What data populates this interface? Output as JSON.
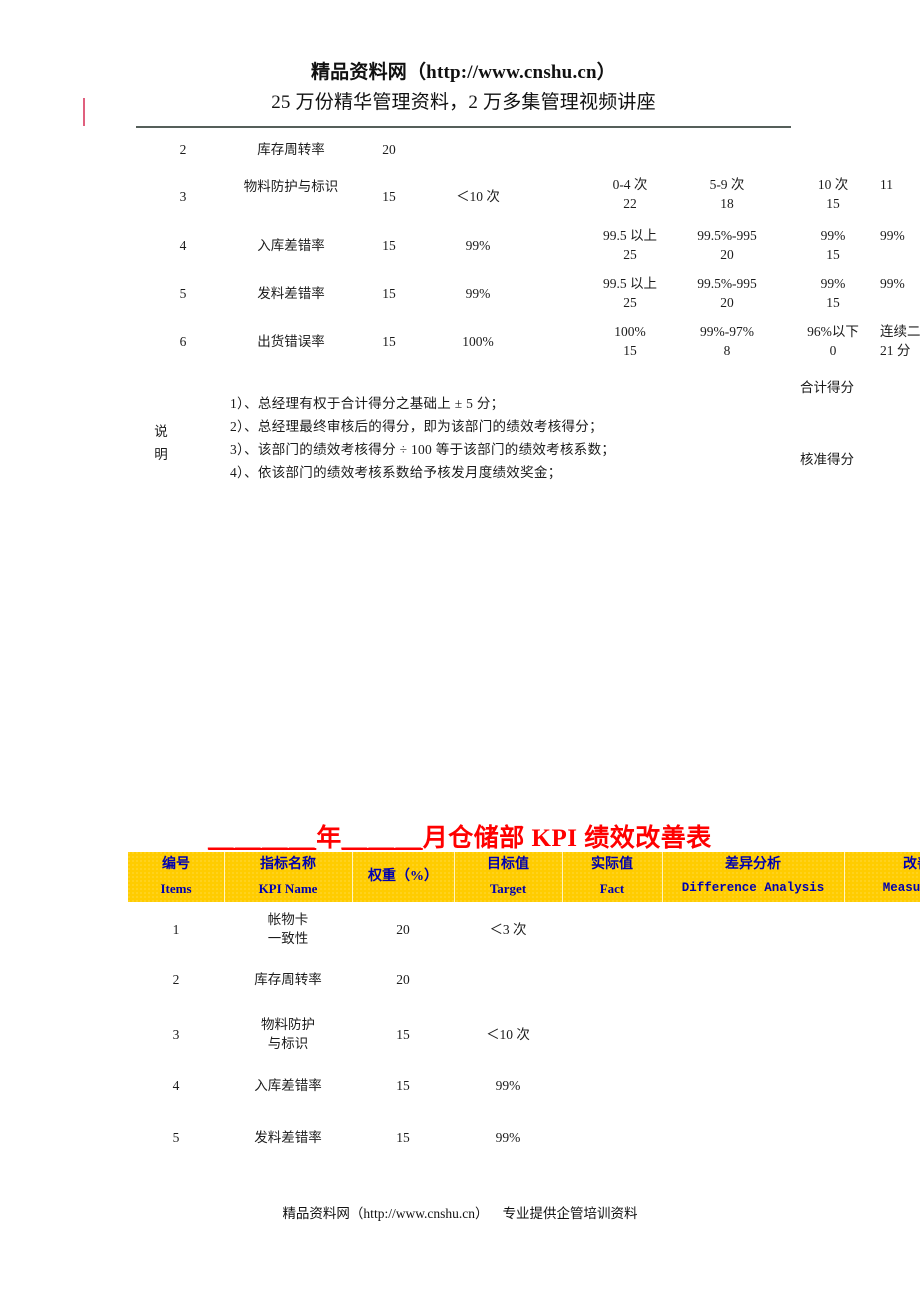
{
  "header": {
    "line1": "精品资料网（http://www.cnshu.cn）",
    "line2": "25 万份精华管理资料，2 万多集管理视频讲座"
  },
  "table1": {
    "rows": [
      {
        "no": "2",
        "name": "库存周转率",
        "weight": "20",
        "target": "",
        "grades": [
          {
            "label": "",
            "score": ""
          },
          {
            "label": "",
            "score": ""
          },
          {
            "label": "",
            "score": ""
          },
          {
            "label": "",
            "score": ""
          }
        ]
      },
      {
        "no": "3",
        "name": "物料防护与标识",
        "weight": "15",
        "target": "＜10 次",
        "grades": [
          {
            "label": "0-4 次",
            "score": "22"
          },
          {
            "label": "5-9 次",
            "score": "18"
          },
          {
            "label": "10 次",
            "score": "15"
          },
          {
            "label": "11",
            "score": ""
          }
        ]
      },
      {
        "no": "4",
        "name": "入库差错率",
        "weight": "15",
        "target": "99%",
        "grades": [
          {
            "label": "99.5 以上",
            "score": "25"
          },
          {
            "label": "99.5%-995",
            "score": "20"
          },
          {
            "label": "99%",
            "score": "15"
          },
          {
            "label": "99%",
            "score": ""
          }
        ]
      },
      {
        "no": "5",
        "name": "发料差错率",
        "weight": "15",
        "target": "99%",
        "grades": [
          {
            "label": "99.5 以上",
            "score": "25"
          },
          {
            "label": "99.5%-995",
            "score": "20"
          },
          {
            "label": "99%",
            "score": "15"
          },
          {
            "label": "99%",
            "score": ""
          }
        ]
      },
      {
        "no": "6",
        "name": "出货错误率",
        "weight": "15",
        "target": "100%",
        "grades": [
          {
            "label": "100%",
            "score": "15"
          },
          {
            "label": "99%-97%",
            "score": "8"
          },
          {
            "label": "96%以下",
            "score": "0"
          },
          {
            "label": "连续二",
            "score": "21 分"
          }
        ]
      }
    ]
  },
  "explanation": {
    "label_char1": "说",
    "label_char2": "明",
    "items": [
      "1）、总经理有权于合计得分之基础上 ± 5 分；",
      "2）、总经理最终审核后的得分，即为该部门的绩效考核得分；",
      "3）、该部门的绩效考核得分 ÷ 100 等于该部门的绩效考核系数；",
      "4）、依该部门的绩效考核系数给予核发月度绩效奖金；"
    ],
    "total_score_label": "合计得分",
    "approved_score_label": "核准得分"
  },
  "section2": {
    "title_blank1": "＿＿＿＿",
    "title_year": "年",
    "title_blank2": "＿＿＿",
    "title_rest": "月仓储部 KPI 绩效改善表",
    "header_bg": "#FFCC00",
    "header_text_color": "#0000B0",
    "title_color": "#FF0000",
    "columns": [
      {
        "cn": "编号",
        "en": "Items"
      },
      {
        "cn": "指标名称",
        "en": "KPI Name"
      },
      {
        "cn": "权重（%）",
        "en": ""
      },
      {
        "cn": "目标值",
        "en": "Target"
      },
      {
        "cn": "实际值",
        "en": "Fact"
      },
      {
        "cn": "差异分析",
        "en": "Difference Analysis"
      },
      {
        "cn": "改善措",
        "en": "Measures of"
      }
    ],
    "rows": [
      {
        "no": "1",
        "name_l1": "帐物卡",
        "name_l2": "一致性",
        "weight": "20",
        "target": "＜3 次",
        "fact": "",
        "diff": "",
        "measures": ""
      },
      {
        "no": "2",
        "name_l1": "库存周转率",
        "name_l2": "",
        "weight": "20",
        "target": "",
        "fact": "",
        "diff": "",
        "measures": ""
      },
      {
        "no": "3",
        "name_l1": "物料防护",
        "name_l2": "与标识",
        "weight": "15",
        "target": "＜10 次",
        "fact": "",
        "diff": "",
        "measures": ""
      },
      {
        "no": "4",
        "name_l1": "入库差错率",
        "name_l2": "",
        "weight": "15",
        "target": "99%",
        "fact": "",
        "diff": "",
        "measures": ""
      },
      {
        "no": "5",
        "name_l1": "发料差错率",
        "name_l2": "",
        "weight": "15",
        "target": "99%",
        "fact": "",
        "diff": "",
        "measures": ""
      }
    ]
  },
  "footer": {
    "left": "精品资料网（http://www.cnshu.cn）",
    "right": "专业提供企管培训资料"
  }
}
